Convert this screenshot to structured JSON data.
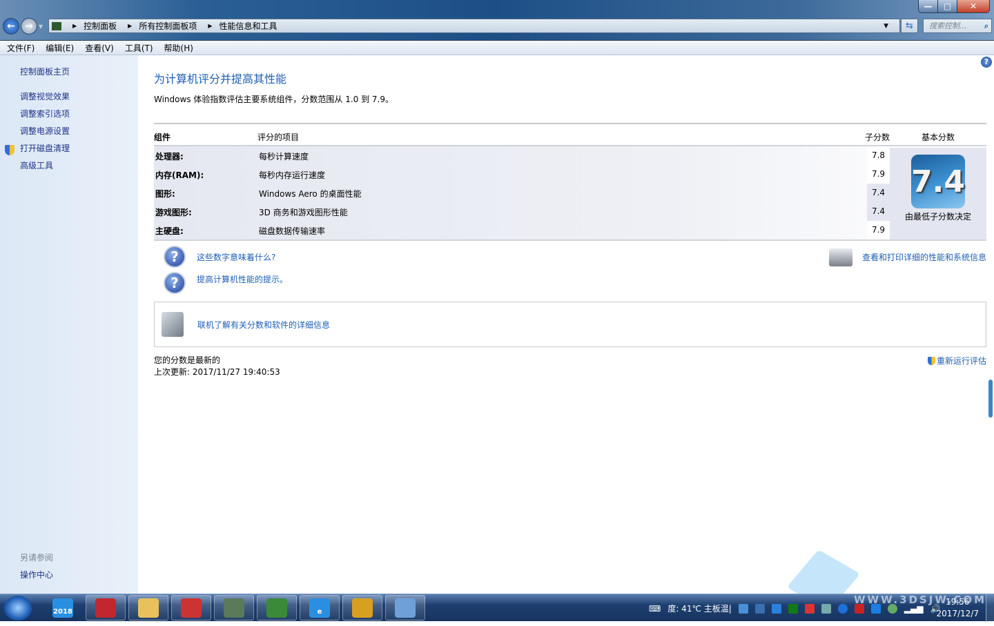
{
  "window": {
    "minimize": "—",
    "maximize": "▢",
    "close": "✕"
  },
  "address": {
    "crumbs": [
      "控制面板",
      "所有控制面板项",
      "性能信息和工具"
    ],
    "search_placeholder": "搜索控制..."
  },
  "menu": [
    "文件(F)",
    "编辑(E)",
    "查看(V)",
    "工具(T)",
    "帮助(H)"
  ],
  "sidebar": {
    "home": "控制面板主页",
    "items": [
      "调整视觉效果",
      "调整索引选项",
      "调整电源设置",
      "打开磁盘清理",
      "高级工具"
    ],
    "see_also": "另请参阅",
    "see_also_items": [
      "操作中心"
    ]
  },
  "main": {
    "title": "为计算机评分并提高其性能",
    "description": "Windows 体验指数评估主要系统组件，分数范围从 1.0 到 7.9。",
    "headers": {
      "component": "组件",
      "rated": "评分的项目",
      "subscore": "子分数",
      "base": "基本分数"
    },
    "rows": [
      {
        "component": "处理器:",
        "item": "每秒计算速度",
        "score": "7.8",
        "lowest": false
      },
      {
        "component": "内存(RAM):",
        "item": "每秒内存运行速度",
        "score": "7.9",
        "lowest": false
      },
      {
        "component": "图形:",
        "item": "Windows Aero 的桌面性能",
        "score": "7.4",
        "lowest": true
      },
      {
        "component": "游戏图形:",
        "item": "3D 商务和游戏图形性能",
        "score": "7.4",
        "lowest": true
      },
      {
        "component": "主硬盘:",
        "item": "磁盘数据传输速率",
        "score": "7.9",
        "lowest": false
      }
    ],
    "base_score": "7.4",
    "base_caption": "由最低子分数决定",
    "links": {
      "what_mean": "这些数字意味着什么?",
      "tips": "提高计算机性能的提示。",
      "print": "查看和打印详细的性能和系统信息",
      "online": "联机了解有关分数和软件的详细信息"
    },
    "status": "您的分数是最新的",
    "last_update": "上次更新: 2017/11/27 19:40:53",
    "rerun": "重新运行评估"
  },
  "taskbar": {
    "apps": [
      "2018",
      "",
      "",
      "",
      "",
      "",
      "e",
      "",
      ""
    ],
    "tray_text": "度: 41℃  主板温|",
    "time": "19:56",
    "date": "2017/12/7"
  },
  "watermark": "WWW.3DSJW.COM"
}
